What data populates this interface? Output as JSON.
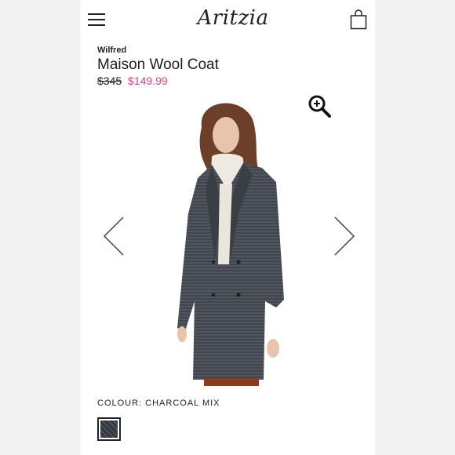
{
  "header": {
    "menu_icon": "hamburger-icon",
    "logo_text": "Aritzia",
    "bag_icon": "shopping-bag-icon"
  },
  "product": {
    "brand": "Wilfred",
    "name": "Maison Wool Coat",
    "original_price": "$345",
    "sale_price": "$149.99",
    "sale_price_color": "#e0457b"
  },
  "gallery": {
    "zoom_icon": "zoom-in-icon",
    "prev_icon": "chevron-left-icon",
    "next_icon": "chevron-right-icon"
  },
  "colour": {
    "label": "COLOUR: CHARCOAL MIX",
    "swatch_color": "#444a51"
  }
}
